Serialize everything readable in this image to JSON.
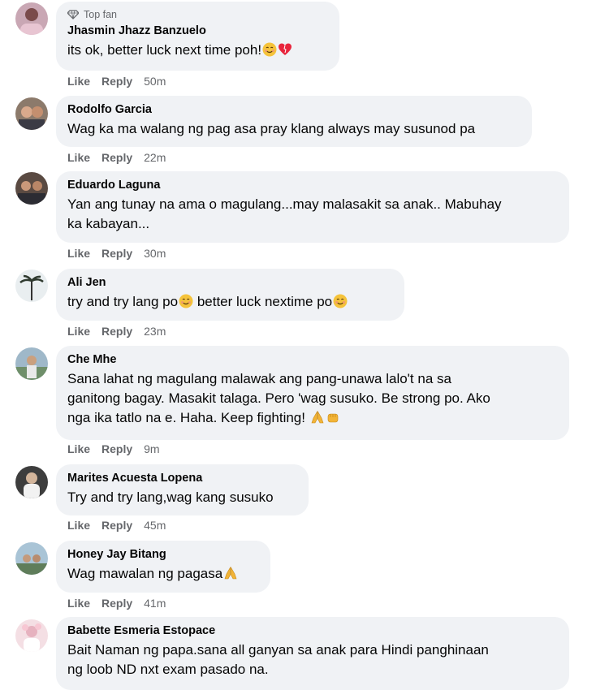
{
  "comments": [
    {
      "author": "Jhasmin Jhazz Banzuelo",
      "badge": "Top fan",
      "text": "its ok, better luck next time poh!",
      "emojis": [
        "smile",
        "heart"
      ],
      "time": "50m"
    },
    {
      "author": "Rodolfo Garcia",
      "text": "Wag ka ma walang ng pag asa pray klang always may susunod pa",
      "time": "22m"
    },
    {
      "author": "Eduardo Laguna",
      "text_lines": [
        "Yan ang tunay na ama o magulang...may malasakit sa anak.. Mabuhay",
        "ka kabayan..."
      ],
      "time": "30m"
    },
    {
      "author": "Ali Jen",
      "text_parts": [
        "try and try lang po",
        "better luck nextime po"
      ],
      "emojis": [
        "smile",
        "smile"
      ],
      "time": "23m"
    },
    {
      "author": "Che Mhe",
      "text_lines": [
        "Sana lahat ng magulang malawak ang pang-unawa lalo't na sa",
        "ganitong bagay. Masakit talaga. Pero 'wag susuko. Be strong po. Ako",
        "nga ika tatlo na e. Haha. Keep fighting!"
      ],
      "emojis": [
        "pray",
        "fist"
      ],
      "time": "9m"
    },
    {
      "author": "Marites Acuesta Lopena",
      "text": "Try and try lang,wag kang susuko",
      "time": "45m"
    },
    {
      "author": "Honey Jay Bitang",
      "text": "Wag mawalan ng pagasa",
      "emojis": [
        "pray"
      ],
      "time": "41m"
    },
    {
      "author": "Babette Esmeria Estopace",
      "text_lines": [
        "Bait Naman ng papa.sana all ganyan sa anak para Hindi panghinaan",
        "ng loob ND nxt exam pasado na."
      ]
    }
  ],
  "actions": {
    "like": "Like",
    "reply": "Reply"
  },
  "colors": {
    "bubble": "#f0f2f5",
    "meta": "#65676b",
    "text": "#050505"
  }
}
